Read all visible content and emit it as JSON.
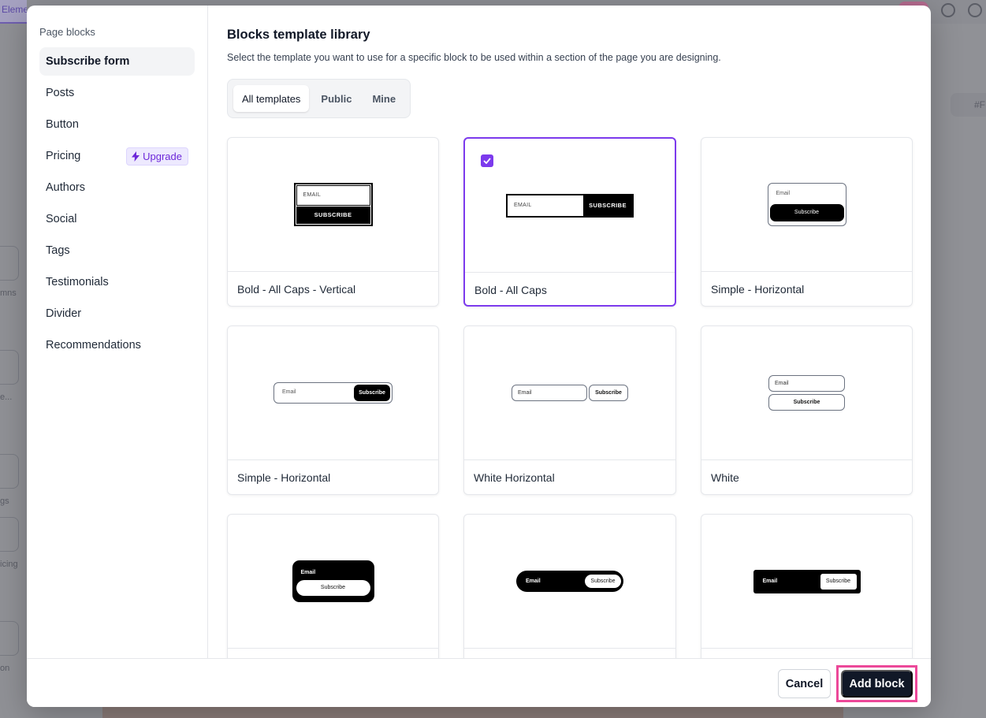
{
  "background": {
    "tab_fragment": "Elemen",
    "left_labels": [
      "mns",
      "e...",
      "gs",
      "icing",
      "on"
    ],
    "right_chip": "#F"
  },
  "sidebar": {
    "title": "Page blocks",
    "items": [
      {
        "label": "Subscribe form",
        "active": true
      },
      {
        "label": "Posts"
      },
      {
        "label": "Button"
      },
      {
        "label": "Pricing",
        "badge": "Upgrade"
      },
      {
        "label": "Authors"
      },
      {
        "label": "Social"
      },
      {
        "label": "Tags"
      },
      {
        "label": "Testimonials"
      },
      {
        "label": "Divider"
      },
      {
        "label": "Recommendations"
      }
    ]
  },
  "main": {
    "title": "Blocks template library",
    "subtitle": "Select the template you want to use for a specific block to be used within a section of the page you are designing.",
    "tabs": [
      "All templates",
      "Public",
      "Mine"
    ],
    "active_tab": "All templates",
    "templates": [
      {
        "label": "Bold - All Caps - Vertical",
        "email": "EMAIL",
        "button": "SUBSCRIBE"
      },
      {
        "label": "Bold - All Caps",
        "email": "EMAIL",
        "button": "SUBSCRIBE",
        "selected": true
      },
      {
        "label": "Simple - Horizontal",
        "email": "Email",
        "button": "Subscribe"
      },
      {
        "label": "Simple - Horizontal",
        "email": "Email",
        "button": "Subscribe"
      },
      {
        "label": "White Horizontal",
        "email": "Email",
        "button": "Subscribe"
      },
      {
        "label": "White",
        "email": "Email",
        "button": "Subscribe"
      },
      {
        "label": "",
        "email": "Email",
        "button": "Subscribe"
      },
      {
        "label": "",
        "email": "Email",
        "button": "Subscribe"
      },
      {
        "label": "",
        "email": "Email",
        "button": "Subscribe"
      }
    ]
  },
  "footer": {
    "cancel_label": "Cancel",
    "add_label": "Add block"
  },
  "colors": {
    "accent": "#7c3aed",
    "primary_button": "#111827",
    "highlight": "#ec4899"
  }
}
